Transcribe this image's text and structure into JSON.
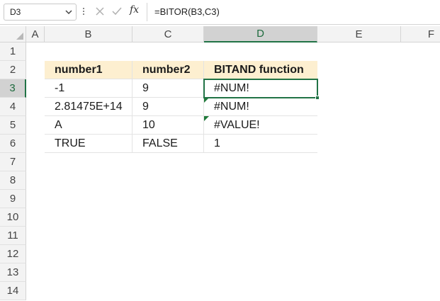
{
  "formula_bar": {
    "name_box": "D3",
    "formula": "=BITOR(B3,C3)",
    "fx_label": "fx"
  },
  "columns": [
    "A",
    "B",
    "C",
    "D",
    "E",
    "F"
  ],
  "active_column": "D",
  "rows": [
    "1",
    "2",
    "3",
    "4",
    "5",
    "6",
    "7",
    "8",
    "9",
    "10",
    "11",
    "12",
    "13",
    "14"
  ],
  "active_row": "3",
  "table": {
    "headers": [
      "number1",
      "number2",
      "BITAND function"
    ],
    "rows": [
      [
        "-1",
        "9",
        "#NUM!"
      ],
      [
        "2.81475E+14",
        "9",
        "#NUM!"
      ],
      [
        "A",
        "10",
        "#VALUE!"
      ],
      [
        "TRUE",
        "FALSE",
        "1"
      ]
    ]
  },
  "colors": {
    "header_fill": "#fdefd0",
    "selection": "#217346",
    "error_indicator": "#1f7a3a"
  }
}
